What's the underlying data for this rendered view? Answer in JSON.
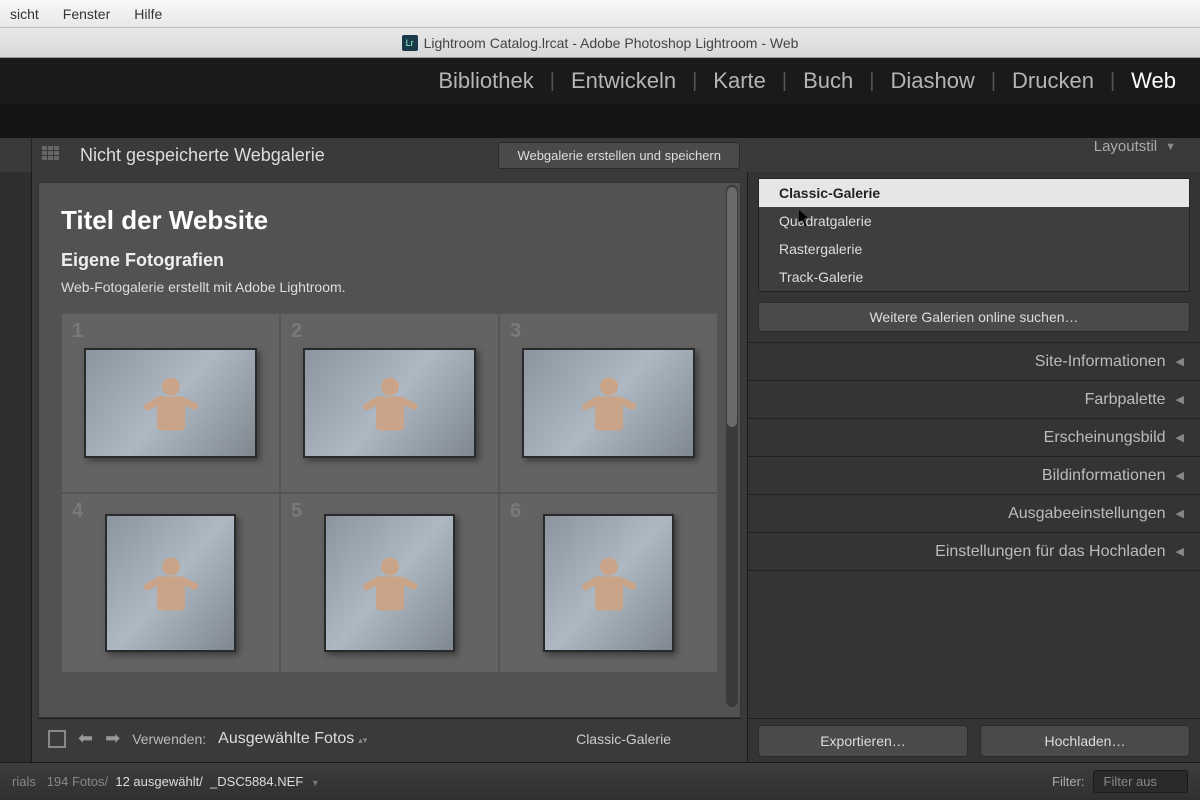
{
  "menubar": {
    "items": [
      "sicht",
      "Fenster",
      "Hilfe"
    ]
  },
  "window": {
    "title": "Lightroom Catalog.lrcat - Adobe Photoshop Lightroom - Web"
  },
  "modules": {
    "items": [
      "Bibliothek",
      "Entwickeln",
      "Karte",
      "Buch",
      "Diashow",
      "Drucken",
      "Web"
    ],
    "active": "Web"
  },
  "toolbar": {
    "title": "Nicht gespeicherte Webgalerie",
    "create_btn": "Webgalerie erstellen und speichern",
    "right_panel_header": "Layoutstil"
  },
  "preview": {
    "site_title": "Titel der Website",
    "collection_title": "Eigene Fotografien",
    "subtitle": "Web-Fotogalerie erstellt mit Adobe Lightroom.",
    "cell_numbers": [
      "1",
      "2",
      "3",
      "4",
      "5",
      "6"
    ]
  },
  "previewbar": {
    "use_label": "Verwenden:",
    "use_value": "Ausgewählte Fotos",
    "style_label": "Classic-Galerie"
  },
  "rightpanel": {
    "styles": [
      "Classic-Galerie",
      "Quadratgalerie",
      "Rastergalerie",
      "Track-Galerie"
    ],
    "selected_style": "Classic-Galerie",
    "more_btn": "Weitere Galerien online suchen…",
    "sections": [
      "Site-Informationen",
      "Farbpalette",
      "Erscheinungsbild",
      "Bildinformationen",
      "Ausgabeeinstellungen",
      "Einstellungen für das Hochladen"
    ],
    "export_btn": "Exportieren…",
    "upload_btn": "Hochladen…"
  },
  "status": {
    "folder": "rials",
    "count_label": "194 Fotos/",
    "selected_label": "12 ausgewählt/",
    "filename": "_DSC5884.NEF",
    "filter_label": "Filter:",
    "filter_value": "Filter aus"
  }
}
